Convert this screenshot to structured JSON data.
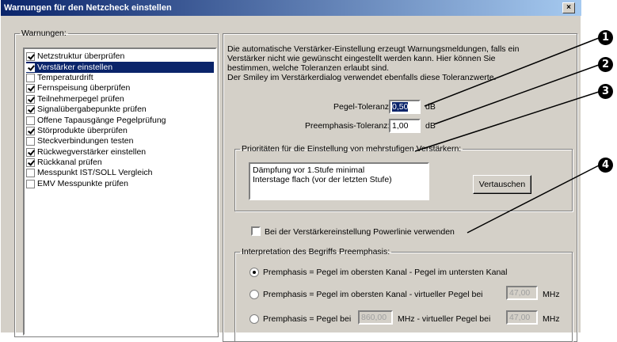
{
  "window": {
    "title": "Warnungen für den Netzcheck einstellen",
    "close": "×"
  },
  "warnings": {
    "legend": "Warnungen:",
    "items": [
      {
        "label": "Netzstruktur überprüfen",
        "checked": true,
        "selected": false
      },
      {
        "label": "Verstärker einstellen",
        "checked": true,
        "selected": true
      },
      {
        "label": "Temperaturdrift",
        "checked": false,
        "selected": false
      },
      {
        "label": "Fernspeisung überprüfen",
        "checked": true,
        "selected": false
      },
      {
        "label": "Teilnehmerpegel prüfen",
        "checked": true,
        "selected": false
      },
      {
        "label": "Signalübergabepunkte prüfen",
        "checked": true,
        "selected": false
      },
      {
        "label": "Offene Tapausgänge Pegelprüfung",
        "checked": false,
        "selected": false
      },
      {
        "label": "Störprodukte überprüfen",
        "checked": true,
        "selected": false
      },
      {
        "label": "Steckverbindungen testen",
        "checked": false,
        "selected": false
      },
      {
        "label": "Rückwegverstärker einstellen",
        "checked": true,
        "selected": false
      },
      {
        "label": "Rückkanal prüfen",
        "checked": true,
        "selected": false
      },
      {
        "label": "Messpunkt IST/SOLL Vergleich",
        "checked": false,
        "selected": false
      },
      {
        "label": "EMV Messpunkte prüfen",
        "checked": false,
        "selected": false
      }
    ]
  },
  "description": {
    "line1": "Die automatische Verstärker-Einstellung erzeugt Warnungsmeldungen, falls ein",
    "line2": "Verstärker nicht wie gewünscht eingestellt werden kann. Hier können Sie",
    "line3": "bestimmen, welche Toleranzen erlaubt sind.",
    "line4": "Der Smiley im Verstärkerdialog verwendet ebenfalls diese Toleranzwerte."
  },
  "tolerances": {
    "pegel_label": "Pegel-Toleranz:",
    "pegel_value": "0,50",
    "pegel_unit": "dB",
    "preemphasis_label": "Preemphasis-Toleranz:",
    "preemphasis_value": "1,00",
    "preemphasis_unit": "dB"
  },
  "priorities": {
    "legend": "Prioritäten für die Einstellung von mehrstufigen Verstärkern:",
    "items": [
      "Dämpfung vor 1.Stufe minimal",
      "Interstage flach (vor der letzten Stufe)"
    ],
    "swap_button": "Vertauschen"
  },
  "powerline": {
    "label": "Bei der Verstärkereinstellung Powerlinie verwenden",
    "checked": false
  },
  "interpretation": {
    "legend": "Interpretation des Begriffs Preemphasis:",
    "option1": "Premphasis = Pegel im obersten Kanal  -  Pegel im untersten Kanal",
    "option2": "Premphasis = Pegel im obersten Kanal  -  virtueller Pegel bei",
    "option2_value": "47,00",
    "option2_unit": "MHz",
    "option3_prefix": "Premphasis = Pegel bei",
    "option3_value1": "860,00",
    "option3_mid": "MHz  -  virtueller Pegel bei",
    "option3_value2": "47,00",
    "option3_unit": "MHz",
    "selected": 1
  },
  "callouts": [
    "1",
    "2",
    "3",
    "4"
  ]
}
